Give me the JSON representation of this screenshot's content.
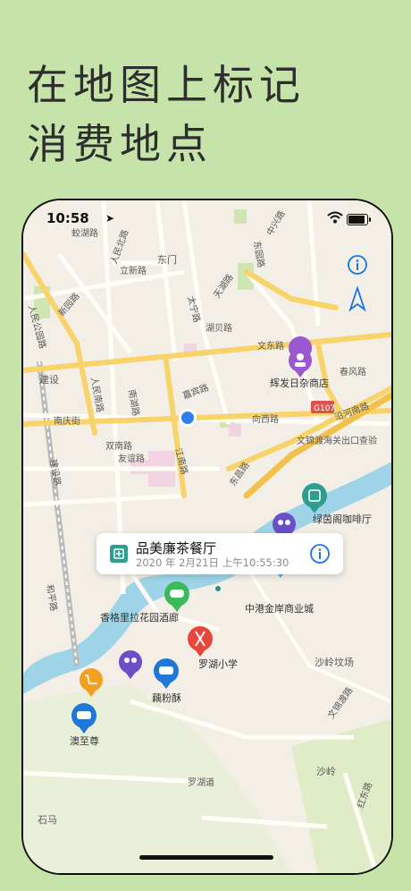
{
  "headline": {
    "line1": "在地图上标记",
    "line2": "消费地点"
  },
  "status_bar": {
    "time": "10:58",
    "location_arrow": "➤",
    "battery_level": 0.8
  },
  "colors": {
    "background": "#c6e3a9",
    "map_base": "#f3efe6",
    "water": "#9fd4e8",
    "road_main": "#f7d36a",
    "road_minor": "#fffdf6",
    "park": "#cfe6b2",
    "user_dot": "#2f80ed",
    "system_blue": "#1a73e8"
  },
  "map": {
    "road_labels": [
      "蛟湖路",
      "人民北路",
      "嘉宾路",
      "东门",
      "立新路",
      "新园路",
      "人民公园路",
      "东园路",
      "湖贝路",
      "太宁路",
      "中兴路",
      "天湖路",
      "建设",
      "人民南路",
      "南湖路",
      "春风路",
      "文东路",
      "向西路",
      "沿河南路",
      "双南路",
      "友谊路",
      "建设路",
      "和平路",
      "宝安南路",
      "南庆街",
      "江南路",
      "东昌路",
      "罗湖道",
      "沙岭坟场",
      "沙岭",
      "文锦渡路",
      "红东路",
      "石马",
      "G107",
      "文锦渡海关出口查验"
    ],
    "user_location_label": "",
    "pois": [
      {
        "name": "辉发日杂商店",
        "color": "#9b59d0",
        "icon": "person-icon"
      },
      {
        "name": "绿茵阁咖啡厅",
        "color": "#2f9e8f",
        "icon": "tea-icon"
      },
      {
        "name": "中港金岸商业城",
        "color": "#5ab0ea",
        "icon": "book-icon"
      },
      {
        "name": "香格里拉花园酒廊",
        "color": "#3cba5a",
        "icon": "gamepad-icon"
      },
      {
        "name": "罗湖小学",
        "color": "#e8463a",
        "icon": "fork-knife-icon"
      },
      {
        "name": "藕粉酥",
        "color": "#1f78d8",
        "icon": "car-icon"
      },
      {
        "name": "澳至尊",
        "color": "#1f78d8",
        "icon": "car-icon"
      },
      {
        "name": "",
        "color": "#f2a01e",
        "icon": "cart-icon"
      },
      {
        "name": "",
        "color": "#6a4fc9",
        "icon": "people-icon"
      },
      {
        "name": "",
        "color": "#6a4fc9",
        "icon": "people-icon"
      }
    ]
  },
  "callout": {
    "title": "品美廉茶餐厅",
    "subtitle": "2020 年 2月21日 上午10:55:30",
    "icon": "tea-icon",
    "info_icon": "info-icon"
  },
  "controls": {
    "info": "info-icon",
    "compass": "compass-arrow-icon"
  }
}
